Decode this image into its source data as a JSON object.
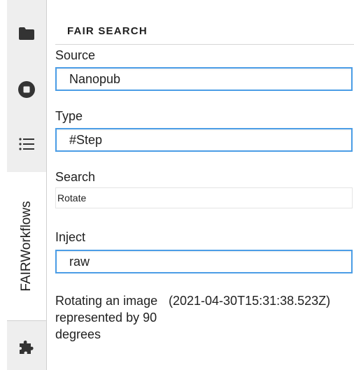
{
  "sidebar": {
    "icons": [
      {
        "name": "folder-icon"
      },
      {
        "name": "stop-circle-icon"
      },
      {
        "name": "list-icon"
      },
      {
        "name": "puzzle-icon"
      }
    ],
    "vertical_tab_label": "FAIRWorkflows"
  },
  "panel": {
    "title": "FAIR SEARCH",
    "source": {
      "label": "Source",
      "value": "Nanopub"
    },
    "type": {
      "label": "Type",
      "value": "#Step"
    },
    "search": {
      "label": "Search",
      "value": "Rotate"
    },
    "inject": {
      "label": "Inject",
      "value": "raw"
    },
    "results": [
      {
        "description": "Rotating an image represented by 90 degrees",
        "timestamp": "(2021-04-30T15:31:38.523Z)"
      }
    ]
  },
  "colors": {
    "accent_border": "#4b9de6",
    "icon": "#333333",
    "sidebar_bg": "#eeeeee"
  }
}
